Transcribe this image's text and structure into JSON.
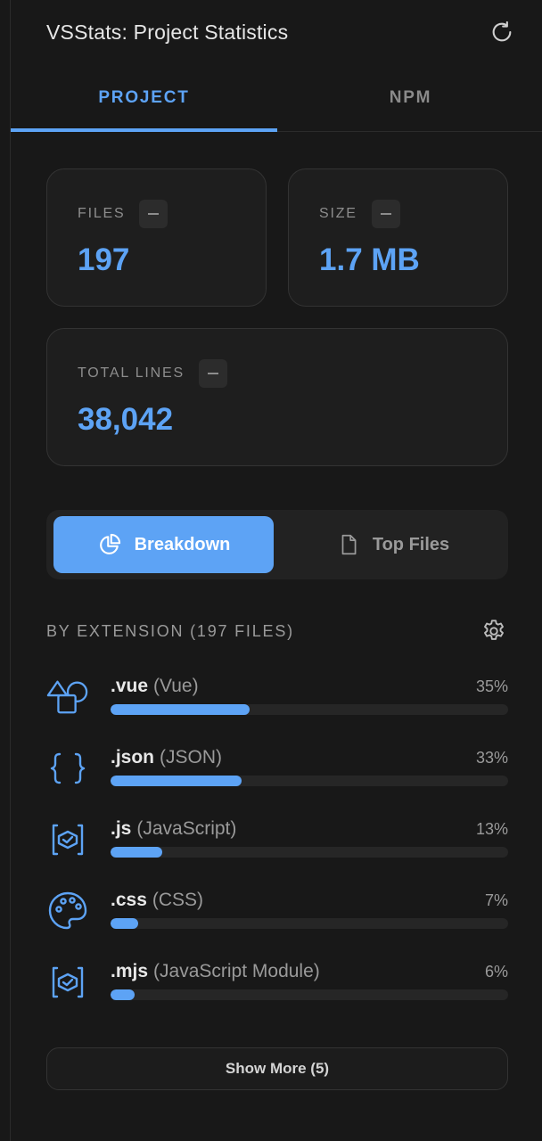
{
  "header": {
    "title": "VSStats: Project Statistics",
    "refresh_icon": "refresh-icon"
  },
  "tabs": [
    {
      "label": "PROJECT",
      "active": true
    },
    {
      "label": "NPM",
      "active": false
    }
  ],
  "stats": {
    "files": {
      "label": "FILES",
      "value": "197"
    },
    "size": {
      "label": "SIZE",
      "value": "1.7 MB"
    },
    "lines": {
      "label": "TOTAL LINES",
      "value": "38,042"
    }
  },
  "view_toggle": {
    "breakdown": "Breakdown",
    "top_files": "Top Files"
  },
  "breakdown": {
    "title": "BY EXTENSION (197 FILES)",
    "items": [
      {
        "ext": ".vue",
        "lang": "(Vue)",
        "pct_label": "35%",
        "pct": 35,
        "icon": "shapes-icon"
      },
      {
        "ext": ".json",
        "lang": "(JSON)",
        "pct_label": "33%",
        "pct": 33,
        "icon": "braces-icon"
      },
      {
        "ext": ".js",
        "lang": "(JavaScript)",
        "pct_label": "13%",
        "pct": 13,
        "icon": "code-file-icon"
      },
      {
        "ext": ".css",
        "lang": "(CSS)",
        "pct_label": "7%",
        "pct": 7,
        "icon": "palette-icon"
      },
      {
        "ext": ".mjs",
        "lang": "(JavaScript Module)",
        "pct_label": "6%",
        "pct": 6,
        "icon": "code-file-icon"
      }
    ],
    "show_more": "Show More (5)"
  },
  "colors": {
    "accent": "#5da3f5",
    "background": "#181818",
    "card": "#1e1e1e"
  }
}
